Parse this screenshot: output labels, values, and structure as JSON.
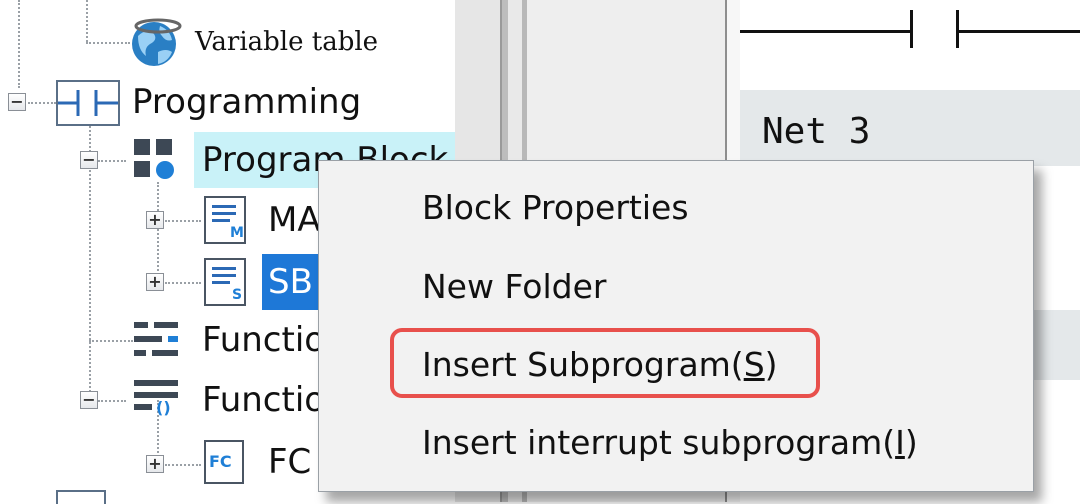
{
  "tree": {
    "variable_table": "Variable table",
    "programming": "Programming",
    "program_block": "Program Block",
    "main": "MA",
    "sbr": "SB",
    "function_1": "Functio",
    "function_2": "Functio",
    "fc": "FC"
  },
  "editor": {
    "network_title": "Net 3"
  },
  "context_menu": {
    "items": [
      {
        "label": "Block Properties"
      },
      {
        "label": "New Folder"
      },
      {
        "label_prefix": "Insert Subprogram(",
        "accel": "S",
        "label_suffix": ")"
      },
      {
        "label_prefix": "Insert interrupt subprogram(",
        "accel": "I",
        "label_suffix": ")"
      }
    ]
  },
  "icons": {
    "globe": "globe-icon",
    "ladder": "ladder-contact-icon",
    "blocks": "program-blocks-icon",
    "doc_m": "main-block-icon",
    "doc_s": "subroutine-icon",
    "func": "function-icon",
    "fc": "fc-icon"
  },
  "colors": {
    "selection_light": "#c9f2f8",
    "selection_dark": "#1e78d7",
    "highlight_box": "#e8504c",
    "menu_bg": "#f2f2f2"
  }
}
